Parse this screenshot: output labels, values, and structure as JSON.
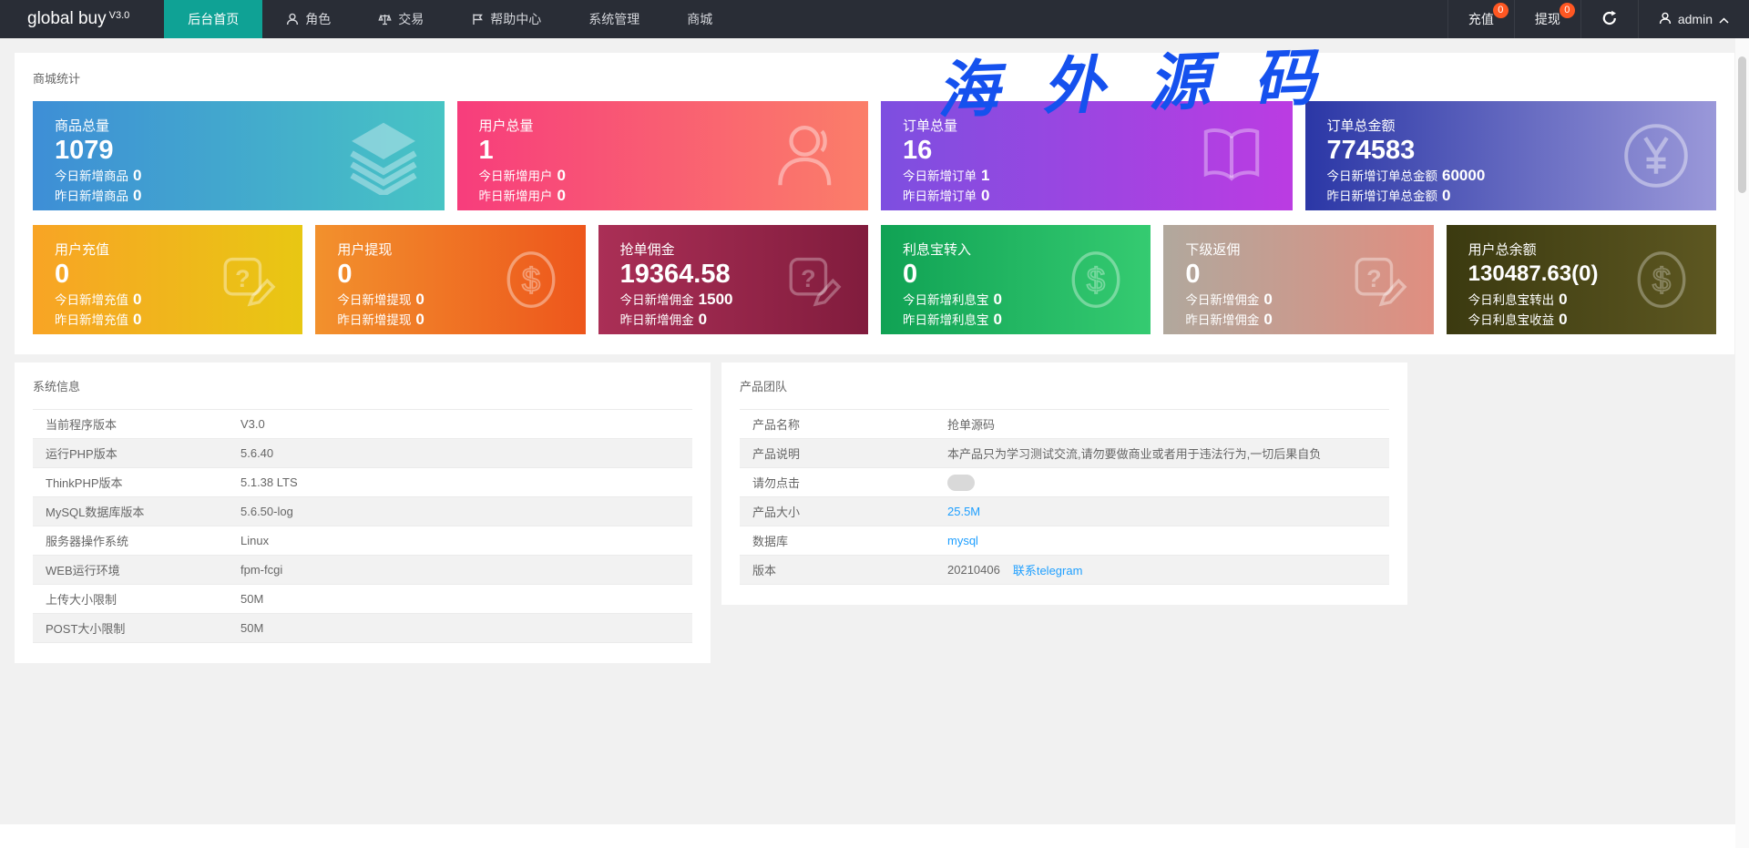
{
  "navbar": {
    "logo_title": "global buy",
    "logo_version": "V3.0",
    "items": [
      {
        "label": "后台首页"
      },
      {
        "label": "角色"
      },
      {
        "label": "交易"
      },
      {
        "label": "帮助中心"
      },
      {
        "label": "系统管理"
      },
      {
        "label": "商城"
      }
    ],
    "recharge_label": "充值",
    "recharge_badge": "0",
    "withdraw_label": "提现",
    "withdraw_badge": "0",
    "admin_label": "admin"
  },
  "watermark_text": "海外源码",
  "colors": {
    "navbar_bg": "#292d36",
    "active_menu": "#0fa295",
    "badge": "#ff5722",
    "link": "#1e9fff",
    "watermark": "#1551ee",
    "page_bg": "#f1f1f1"
  },
  "stats": {
    "title": "商城统计",
    "big_cards": [
      {
        "title": "商品总量",
        "value": "1079",
        "line1_label": "今日新增商品",
        "line1_value": "0",
        "line2_label": "昨日新增商品",
        "line2_value": "0",
        "icon": "layers-icon",
        "from": "#3e8ed6",
        "to": "#47c4c4"
      },
      {
        "title": "用户总量",
        "value": "1",
        "line1_label": "今日新增用户",
        "line1_value": "0",
        "line2_label": "昨日新增用户",
        "line2_value": "0",
        "icon": "user-icon",
        "from": "#f73d7c",
        "to": "#fb7e69"
      },
      {
        "title": "订单总量",
        "value": "16",
        "line1_label": "今日新增订单",
        "line1_value": "1",
        "line2_label": "昨日新增订单",
        "line2_value": "0",
        "icon": "book-icon",
        "from": "#7d4fe0",
        "to": "#bb3ce2"
      },
      {
        "title": "订单总金额",
        "value": "774583",
        "line1_label": "今日新增订单总金额",
        "line1_value": "60000",
        "line2_label": "昨日新增订单总金额",
        "line2_value": "0",
        "icon": "yen-circle-icon",
        "from": "#2b37a6",
        "to": "#9a98d9"
      }
    ],
    "small_cards": [
      {
        "title": "用户充值",
        "value": "0",
        "line1_label": "今日新增充值",
        "line1_value": "0",
        "line2_label": "昨日新增充值",
        "line2_value": "0",
        "icon": "edit-question-icon",
        "from": "#f8a425",
        "to": "#e8c713"
      },
      {
        "title": "用户提现",
        "value": "0",
        "line1_label": "今日新增提现",
        "line1_value": "0",
        "line2_label": "昨日新增提现",
        "line2_value": "0",
        "icon": "dollar-circle-icon",
        "from": "#f2912d",
        "to": "#ed561c"
      },
      {
        "title": "抢单佣金",
        "value": "19364.58",
        "line1_label": "今日新增佣金",
        "line1_value": "1500",
        "line2_label": "昨日新增佣金",
        "line2_value": "0",
        "icon": "edit-question-icon",
        "from": "#aa2f56",
        "to": "#811c3d"
      },
      {
        "title": "利息宝转入",
        "value": "0",
        "line1_label": "今日新增利息宝",
        "line1_value": "0",
        "line2_label": "昨日新增利息宝",
        "line2_value": "0",
        "icon": "dollar-circle-icon",
        "from": "#10a254",
        "to": "#35cb71"
      },
      {
        "title": "下级返佣",
        "value": "0",
        "line1_label": "今日新增佣金",
        "line1_value": "0",
        "line2_label": "昨日新增佣金",
        "line2_value": "0",
        "icon": "edit-question-icon",
        "from": "#b1a89d",
        "to": "#e08e80"
      },
      {
        "title": "用户总余额",
        "value": "130487.63(0)",
        "line1_label": "今日利息宝转出",
        "line1_value": "0",
        "line2_label": "今日利息宝收益",
        "line2_value": "0",
        "icon": "dollar-circle-icon",
        "from": "#3b3a10",
        "to": "#5d5721"
      }
    ]
  },
  "system_info": {
    "title": "系统信息",
    "rows": [
      {
        "label": "当前程序版本",
        "value": "V3.0"
      },
      {
        "label": "运行PHP版本",
        "value": "5.6.40"
      },
      {
        "label": "ThinkPHP版本",
        "value": "5.1.38 LTS"
      },
      {
        "label": "MySQL数据库版本",
        "value": "5.6.50-log"
      },
      {
        "label": "服务器操作系统",
        "value": "Linux"
      },
      {
        "label": "WEB运行环境",
        "value": "fpm-fcgi"
      },
      {
        "label": "上传大小限制",
        "value": "50M"
      },
      {
        "label": "POST大小限制",
        "value": "50M"
      }
    ]
  },
  "product_team": {
    "title": "产品团队",
    "rows": [
      {
        "label": "产品名称",
        "value": "抢单源码"
      },
      {
        "label": "产品说明",
        "value": "本产品只为学习测试交流,请勿要做商业或者用于违法行为,一切后果自负"
      },
      {
        "label": "请勿点击",
        "value": ""
      },
      {
        "label": "产品大小",
        "link": "25.5M"
      },
      {
        "label": "数据库",
        "link": "mysql"
      },
      {
        "label": "版本",
        "value": "20210406",
        "link": "联系telegram"
      }
    ]
  }
}
